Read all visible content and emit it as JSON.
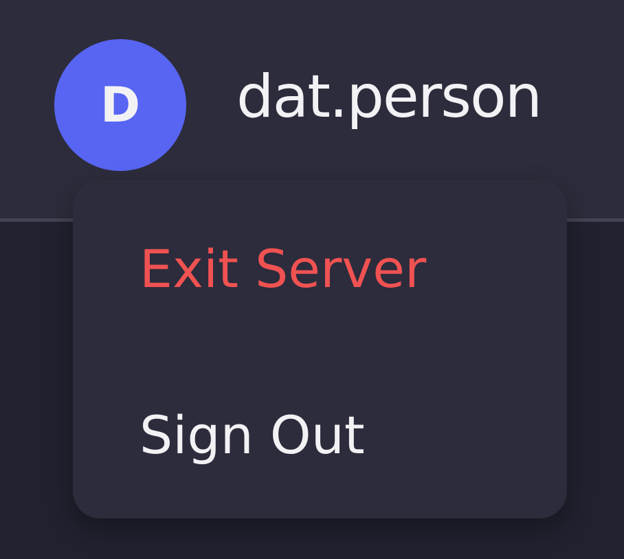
{
  "user": {
    "avatar_initial": "D",
    "username": "dat.person"
  },
  "menu": {
    "items": [
      {
        "label": "Exit Server",
        "color": "#f05252"
      },
      {
        "label": "Sign Out",
        "color": "#f2f2f5"
      }
    ]
  },
  "colors": {
    "header_background": "#2c2c3c",
    "page_background": "#21212f",
    "avatar_background": "#5865f2",
    "danger": "#f05252",
    "text": "#f2f2f5"
  }
}
